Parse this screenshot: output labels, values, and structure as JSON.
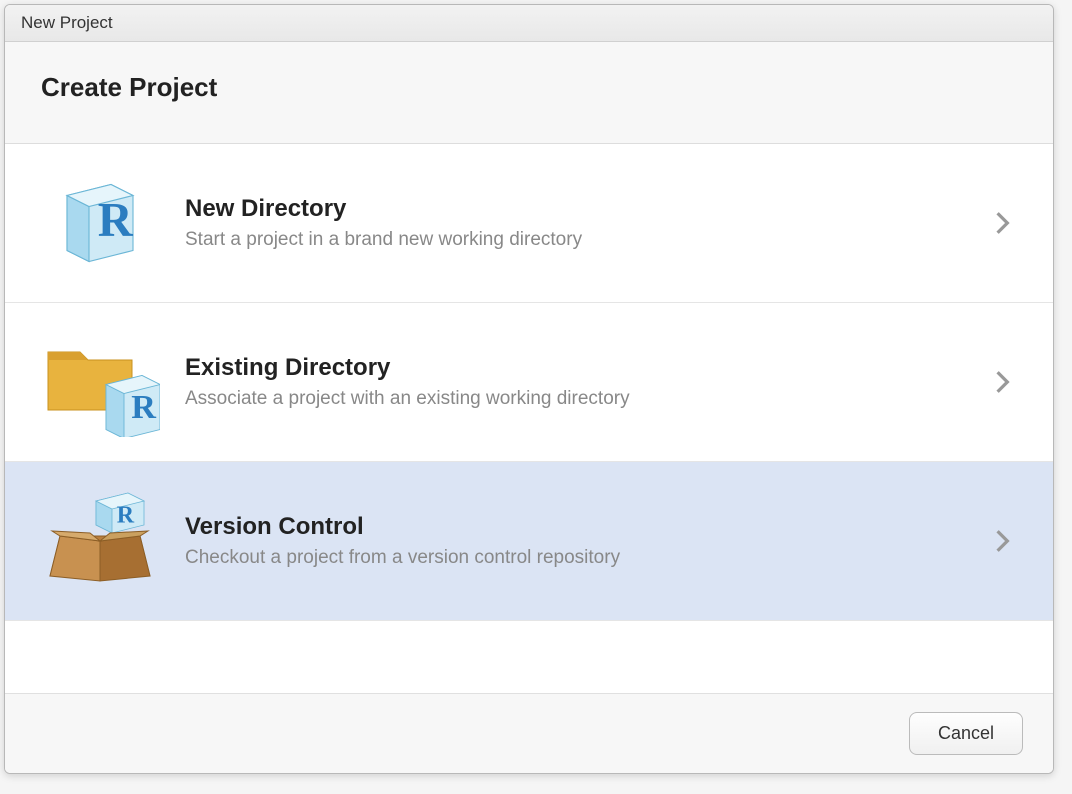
{
  "window": {
    "title": "New Project"
  },
  "header": {
    "title": "Create Project"
  },
  "options": [
    {
      "title": "New Directory",
      "desc": "Start a project in a brand new working directory",
      "selected": false
    },
    {
      "title": "Existing Directory",
      "desc": "Associate a project with an existing working directory",
      "selected": false
    },
    {
      "title": "Version Control",
      "desc": "Checkout a project from a version control repository",
      "selected": true
    }
  ],
  "footer": {
    "cancel": "Cancel"
  }
}
